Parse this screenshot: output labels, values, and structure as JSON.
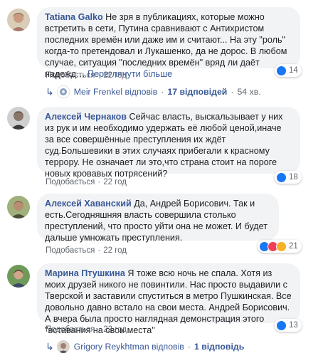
{
  "comments": [
    {
      "author": "Tatiana Galko",
      "text": " Не зря в публикациях, которые можно встретить в сети, Путина сравнивают с Антихристом последних времён или даже им и считают... На эту \"роль\" когда-то претендовал и Лукашенко, да не дорос. В любом случае, ситуация \"последних времён\" вряд ли даёт надежд…",
      "see_more": "Переглянути більше",
      "like_label": "Подобається",
      "age": "22 год",
      "reactions": "14",
      "replies": {
        "name": "Meir Frenkel",
        "action": "відповів",
        "count_label": "17 відповідей",
        "age": "54 хв."
      }
    },
    {
      "author": "Алексей Чернаков",
      "text": " Сейчас власть, выскальзывает у них из рук и им необходимо удержать её любой ценой,иначе за все совершённые преступления их ждёт суд.Большевики в этих случаях прибегали к красному террору. Не означает ли это,что страна стоит на пороге новых кровавых потрясений?",
      "like_label": "Подобається",
      "age": "22 год",
      "reactions": "18"
    },
    {
      "author": "Алексей Хаванский",
      "text": " Да, Андрей Борисович. Так и есть.Сегодняшняя власть совершила столько преступлений, что просто уйти она не может. И будет дальше умножать преступления.",
      "like_label": "Подобається",
      "age": "22 год",
      "reactions": "21"
    },
    {
      "author": "Марина Птушкина",
      "text": " Я тоже всю ночь не спала. Хотя из моих друзей никого не повинтили. Нас просто выдавили с Тверской и заставили спуститься в метро Пушкинская. Все довольно давно встало на свои места. Андрей Борисович. А вчера была просто наглядная демонстрация этого \"вставания на свои места\"",
      "like_label": "Подобається",
      "age": "22 год",
      "reactions": "13",
      "replies": {
        "name": "Grigory Reykhtman",
        "action": "відповів",
        "count_label": "1 відповідь"
      }
    }
  ],
  "separator": "·",
  "colors": {
    "link": "#385898",
    "bubble": "#f2f3f5",
    "like": "#1877f2",
    "love": "#f33e58",
    "wow": "#f7b125"
  }
}
